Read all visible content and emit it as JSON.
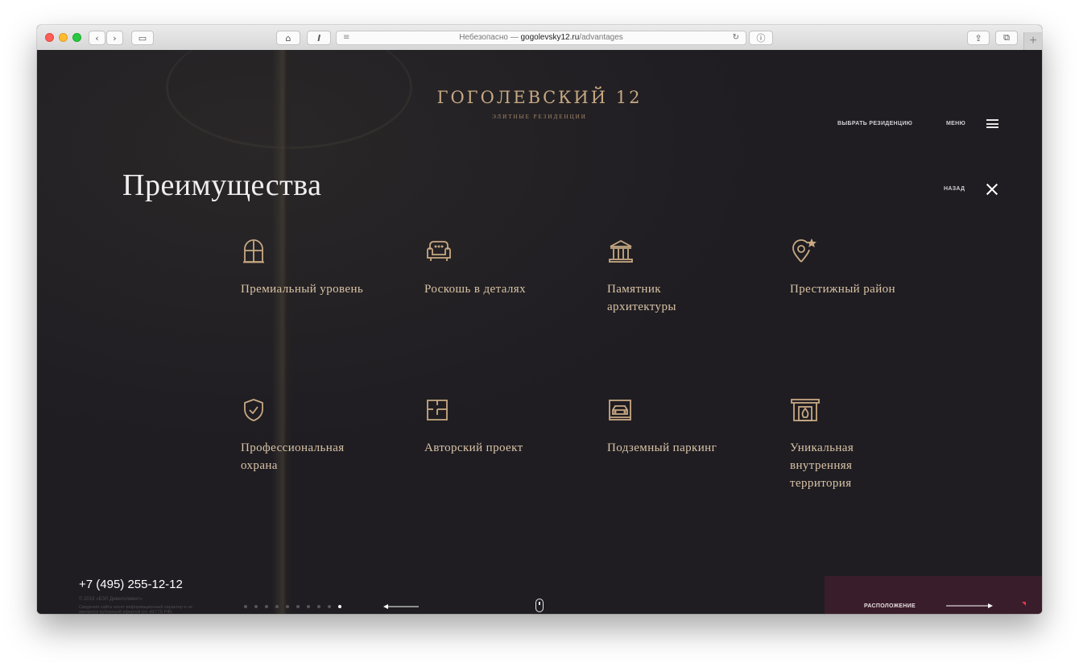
{
  "browser": {
    "address": {
      "prefix": "Небезопасно — ",
      "host": "gogolevsky12.ru",
      "path": "/advantages"
    },
    "buttons": [
      "back",
      "forward",
      "sidebar",
      "home",
      "reading-list",
      "share",
      "tabs",
      "new-tab"
    ]
  },
  "header": {
    "logo_title": "ГОГОЛЕВСКИЙ 12",
    "logo_subtitle": "ЭЛИТНЫЕ РЕЗИДЕНЦИИ",
    "choose_residence": "ВЫБРАТЬ РЕЗИДЕНЦИЮ",
    "menu": "МЕНЮ"
  },
  "page": {
    "title": "Преимущества",
    "back": "НАЗАД"
  },
  "advantages": [
    {
      "label": "Премиальный уровень",
      "icon": "window-icon"
    },
    {
      "label": "Роскошь в деталях",
      "icon": "armchair-icon"
    },
    {
      "label": "Памятник архитектуры",
      "icon": "monument-icon"
    },
    {
      "label": "Престижный район",
      "icon": "location-star-icon"
    },
    {
      "label": "Профессиональная охрана",
      "icon": "shield-check-icon"
    },
    {
      "label": "Авторский проект",
      "icon": "floor-plan-icon"
    },
    {
      "label": "Подземный паркинг",
      "icon": "parking-car-icon"
    },
    {
      "label": "Уникальная внутренняя территория",
      "icon": "fireplace-icon"
    }
  ],
  "footer": {
    "phone": "+7 (495) 255-12-12",
    "copyright": "© 2019 «БЭЛ Девелопмент»",
    "legal": "Сведения сайта носят информационный характер и не являются публичной офертой (ст. 437 ГК РФ)",
    "pagination": {
      "total": 10,
      "active": 10
    },
    "next_section": "РАСПОЛОЖЕНИЕ"
  },
  "colors": {
    "background": "#1f1d22",
    "gold": "#c7a983",
    "label": "#d9c3a6",
    "next_panel": "#3a1d2a",
    "accent_red": "#e1374a"
  }
}
